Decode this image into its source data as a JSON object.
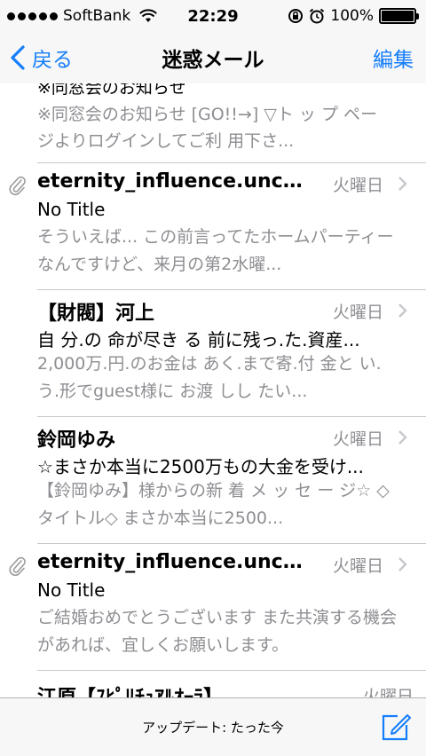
{
  "status_bar": {
    "carrier": "SoftBank",
    "time": "22:29",
    "battery_label": "100%",
    "battery_level": 1.0
  },
  "nav": {
    "back_label": "戻る",
    "title": "迷惑メール",
    "edit_label": "編集"
  },
  "partial_message": {
    "subject": "※同窓会のお知らせ",
    "preview": "※同窓会のお知らせ [GO!!→] ▽ト ッ プ ペー ジよりログインしてご利 用下さ..."
  },
  "messages": [
    {
      "has_attachment": true,
      "sender": "eternity_influence.unco...",
      "date": "火曜日",
      "subject": "No Title",
      "preview": "そういえば... この前言ってたホームパーティーなんですけど、来月の第2水曜..."
    },
    {
      "has_attachment": false,
      "sender": "【財閥】河上",
      "date": "火曜日",
      "subject": "自 分.の 命が尽き る 前に残っ.た.資産...",
      "preview": "2,000万.円.のお金は あく.まで寄.付 金と い.う.形でguest様に お渡 しし たい..."
    },
    {
      "has_attachment": false,
      "sender": "鈴岡ゆみ",
      "date": "火曜日",
      "subject": "☆まさか本当に2500万もの大金を受け...",
      "preview": "【鈴岡ゆみ】様からの新 着 メ ッ セ ー ジ☆ ◇タイトル◇ まさか本当に2500..."
    },
    {
      "has_attachment": true,
      "sender": "eternity_influence.unco...",
      "date": "火曜日",
      "subject": "No Title",
      "preview": "ご結婚おめでとうございます また共演する機会があれば、宜しくお願いします。"
    }
  ],
  "cut_message": {
    "sender": "江原【ｽﾋﾟﾘﾁｭｱﾙｵｰﾗ】",
    "date": "火曜日"
  },
  "toolbar": {
    "update_text": "アップデート: たった今"
  },
  "colors": {
    "accent": "#147efb",
    "secondary_text": "#8e8e93",
    "separator": "#c8c7cc",
    "bar_background": "#f7f7f7"
  },
  "icons": [
    "signal-dots-icon",
    "wifi-icon",
    "rotation-lock-icon",
    "alarm-icon",
    "battery-icon",
    "back-chevron-icon",
    "paperclip-icon",
    "chevron-right-icon",
    "compose-icon"
  ]
}
